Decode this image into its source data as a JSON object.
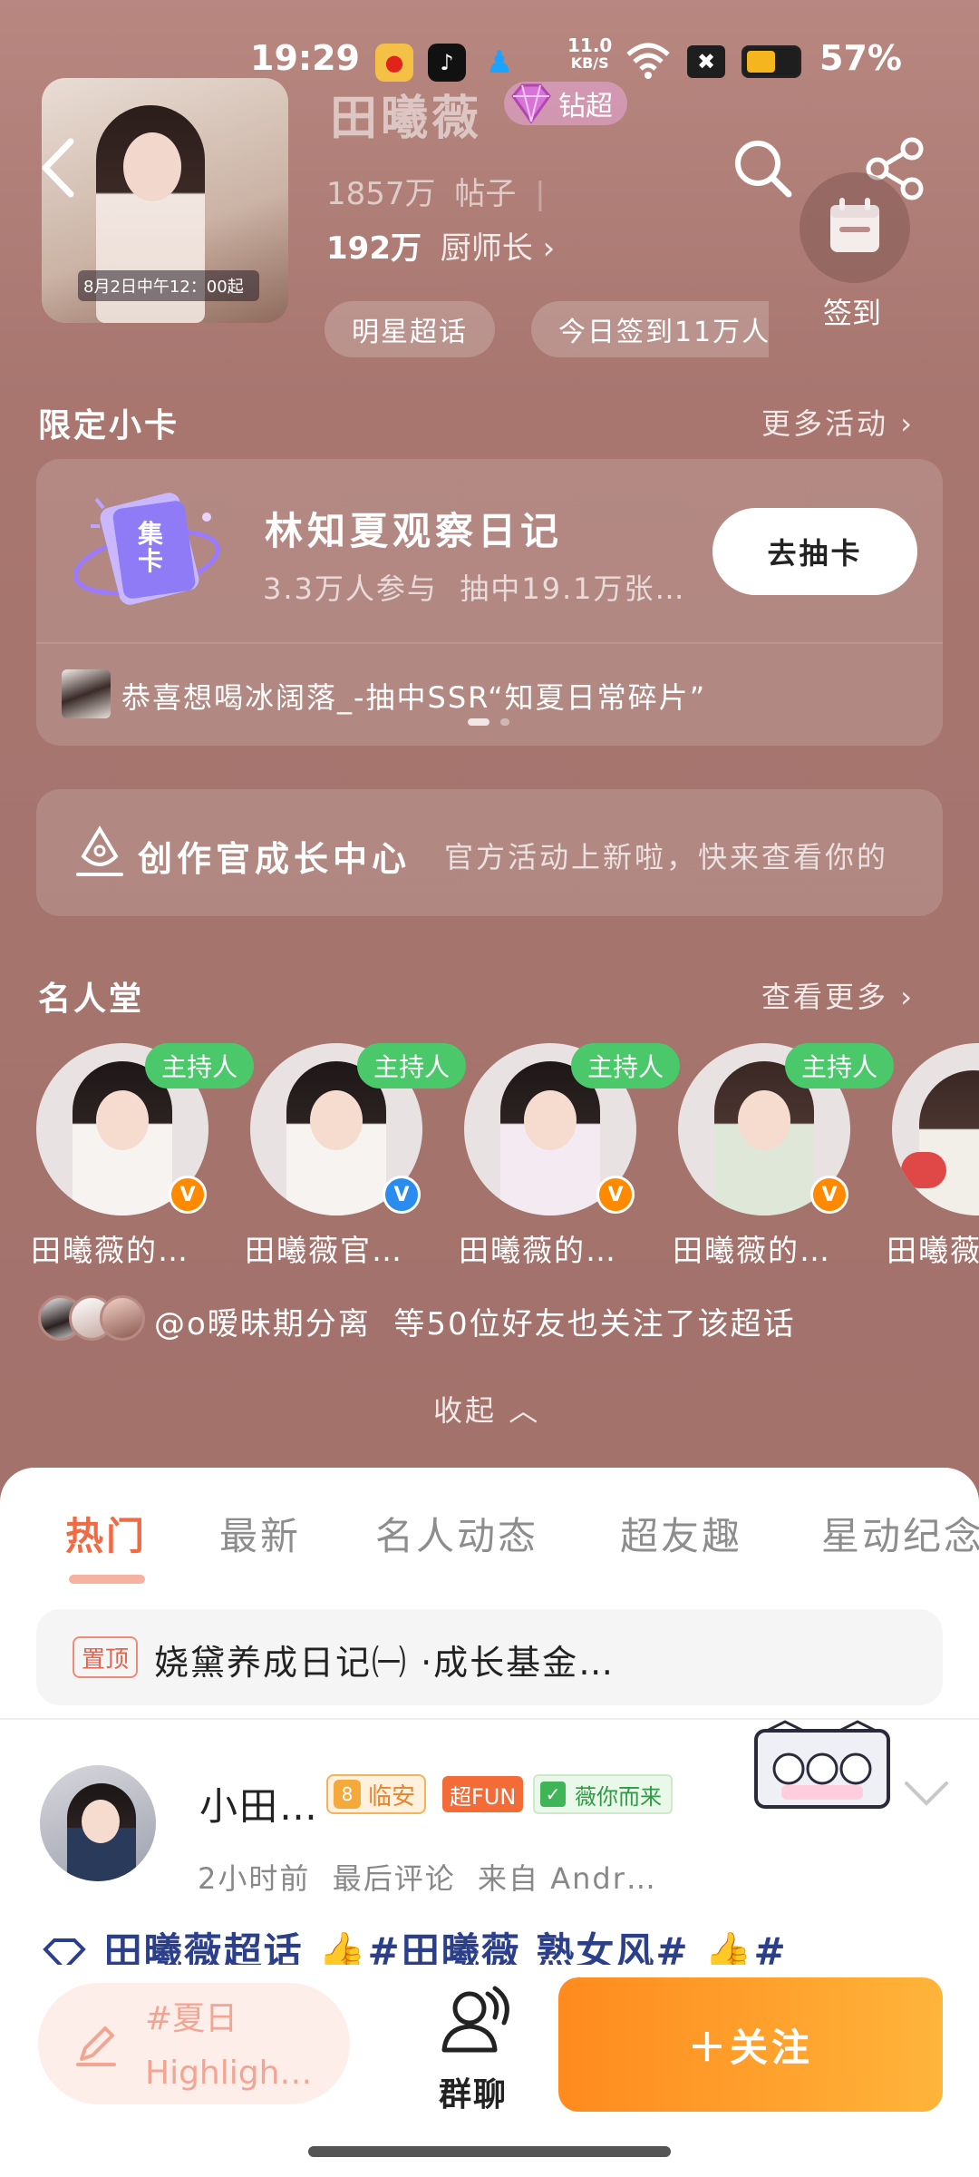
{
  "status_bar": {
    "time": "19:29",
    "net_speed": "11.0",
    "net_unit": "KB/S",
    "battery_pct": "57%",
    "battery_level": 0.57,
    "app_icons": [
      "weibo-icon",
      "tiktok-icon",
      "qq-icon"
    ],
    "icons": [
      "wifi-icon",
      "mute-icon",
      "battery-icon"
    ]
  },
  "header": {
    "title": "田曦薇",
    "diamond_badge": "钻超",
    "posts_count": "1857万",
    "posts_label": "帖子",
    "chef_count": "192万",
    "chef_label": "厨师长",
    "checkin_label": "签到",
    "cover_text": "8月2日中午12：00起",
    "chips": [
      "明星超话",
      "今日签到11万人"
    ]
  },
  "limited_cards": {
    "title": "限定小卡",
    "more": "更多活动",
    "card_icon_text": "集卡",
    "card_title": "林知夏观察日记",
    "card_sub": "3.3万人参与  抽中19.1万张…",
    "draw_button": "去抽卡",
    "ticker": "恭喜想喝冰阔落_-抽中SSR“知夏日常碎片”"
  },
  "creator": {
    "title": "创作官成长中心",
    "desc": "官方活动上新啦，快来查看你的"
  },
  "hall_of_fame": {
    "title": "名人堂",
    "more": "查看更多",
    "members": [
      {
        "name": "田曦薇的…",
        "badge": "主持人",
        "verify": "orange"
      },
      {
        "name": "田曦薇官…",
        "badge": "主持人",
        "verify": "blue"
      },
      {
        "name": "田曦薇的…",
        "badge": "主持人",
        "verify": "orange"
      },
      {
        "name": "田曦薇的…",
        "badge": "主持人",
        "verify": "orange"
      },
      {
        "name": "田曦薇",
        "badge": "",
        "verify": ""
      }
    ],
    "friends_line": "@o暧昧期分离  等50位好友也关注了该超话",
    "collapse": "收起"
  },
  "tabs": [
    "热门",
    "最新",
    "名人动态",
    "超友趣",
    "星动纪念"
  ],
  "active_tab": "热门",
  "pinned": {
    "tag": "置顶",
    "text": "娆黛养成日记㈠ ·成长基金…"
  },
  "post": {
    "user": "小田…",
    "level_num": "8",
    "level_label": "临安",
    "fun_badge": "超FUN",
    "fan_badge": "薇你而来",
    "meta": "2小时前  最后评论  来自 Andr…",
    "body": "田曦薇超话 👍#田曦薇 熟女风# 👍#"
  },
  "bottom_bar": {
    "compose_tag": "#夏日",
    "compose_sub": "Highligh…",
    "group_chat": "群聊",
    "follow": "＋关注"
  },
  "colors": {
    "accent_orange": "#ff8a1d",
    "tab_active": "#f06b44",
    "host_green": "#4ac86a",
    "bg_brown": "#a8766f"
  }
}
